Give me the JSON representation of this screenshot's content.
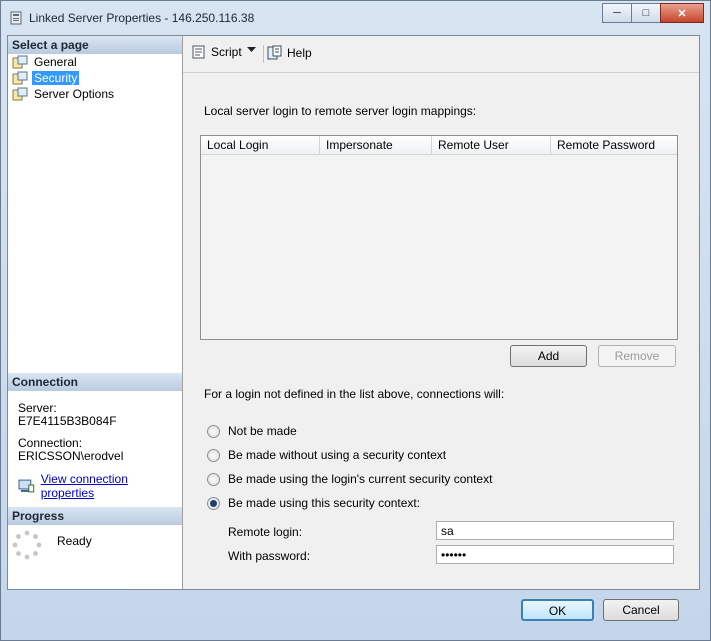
{
  "window": {
    "title": "Linked Server Properties - 146.250.116.38",
    "minimize_glyph": "─",
    "maximize_glyph": "□",
    "close_glyph": "✕"
  },
  "left_pane": {
    "select_page_header": "Select a page",
    "pages": [
      {
        "label": "General",
        "icon": "page-icon",
        "selected": false
      },
      {
        "label": "Security",
        "icon": "page-icon",
        "selected": true
      },
      {
        "label": "Server Options",
        "icon": "page-icon",
        "selected": false
      }
    ],
    "connection_header": "Connection",
    "server_label": "Server:",
    "server_value": "E7E4115B3B084F",
    "connection_label": "Connection:",
    "connection_value": "ERICSSON\\erodvel",
    "view_connection_link": "View connection properties",
    "progress_header": "Progress",
    "progress_status": "Ready"
  },
  "toolbar": {
    "script_label": "Script",
    "help_label": "Help"
  },
  "security": {
    "mappings_label": "Local server login to remote server login mappings:",
    "columns": [
      "Local Login",
      "Impersonate",
      "Remote User",
      "Remote Password"
    ],
    "rows": [],
    "add_button": "Add",
    "remove_button": "Remove",
    "not_defined_label": "For a login not defined in the list above, connections will:",
    "options": [
      {
        "label": "Not be made",
        "checked": false
      },
      {
        "label": "Be made without using a security context",
        "checked": false
      },
      {
        "label": "Be made using the login's current security context",
        "checked": false
      },
      {
        "label": "Be made using this security context:",
        "checked": true
      }
    ],
    "remote_login_label": "Remote login:",
    "remote_login_value": "sa",
    "with_password_label": "With password:",
    "with_password_value": "••••••"
  },
  "footer": {
    "ok_button": "OK",
    "cancel_button": "Cancel"
  },
  "colors": {
    "selection": "#3399ff",
    "link": "#0000cc",
    "header_gradient_top": "#dbe5f1",
    "header_gradient_bottom": "#b9cbe0"
  }
}
